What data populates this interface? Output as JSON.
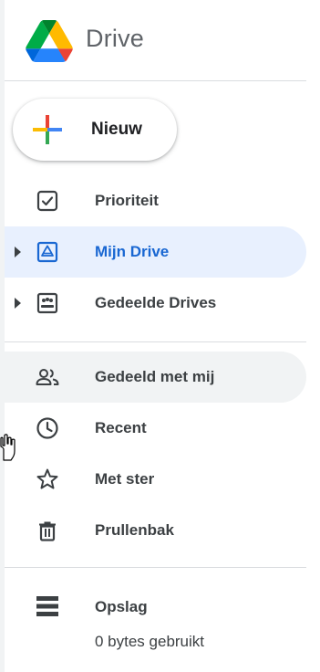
{
  "app": {
    "title": "Drive"
  },
  "new_button": {
    "label": "Nieuw"
  },
  "nav": {
    "items": [
      {
        "label": "Prioriteit",
        "icon": "priority-checkbox-icon",
        "state": "normal"
      },
      {
        "label": "Mijn Drive",
        "icon": "my-drive-icon",
        "state": "active",
        "expandable": true
      },
      {
        "label": "Gedeelde Drives",
        "icon": "shared-drives-icon",
        "state": "normal",
        "expandable": true
      },
      {
        "label": "Gedeeld met mij",
        "icon": "people-icon",
        "state": "hover"
      },
      {
        "label": "Recent",
        "icon": "clock-icon",
        "state": "normal"
      },
      {
        "label": "Met ster",
        "icon": "star-icon",
        "state": "normal"
      },
      {
        "label": "Prullenbak",
        "icon": "trash-icon",
        "state": "normal"
      }
    ]
  },
  "storage": {
    "label": "Opslag",
    "usage": "0 bytes gebruikt",
    "icon": "storage-icon"
  },
  "colors": {
    "accent": "#1967d2",
    "active_bg": "#e8f0fe",
    "hover_bg": "#f1f3f4",
    "text": "#3c4043",
    "divider": "#dadce0"
  }
}
